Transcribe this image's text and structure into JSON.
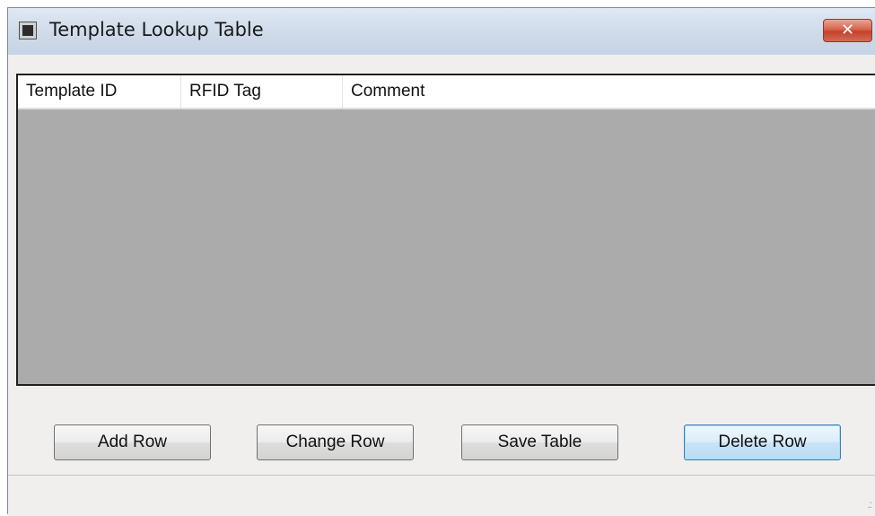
{
  "window": {
    "title": "Template Lookup Table",
    "close_glyph": "✕",
    "icon": "app-window-icon"
  },
  "grid": {
    "columns": [
      "Template ID",
      "RFID Tag",
      "Comment"
    ],
    "rows": []
  },
  "buttons": {
    "add": "Add Row",
    "change": "Change Row",
    "save": "Save Table",
    "delete": "Delete Row"
  },
  "statusbar": {
    "grip_icon": "resize-grip-icon"
  },
  "colors": {
    "grid_background": "#ababab",
    "focused_button_border": "#3c7fb1",
    "close_button": "#c6422c"
  }
}
